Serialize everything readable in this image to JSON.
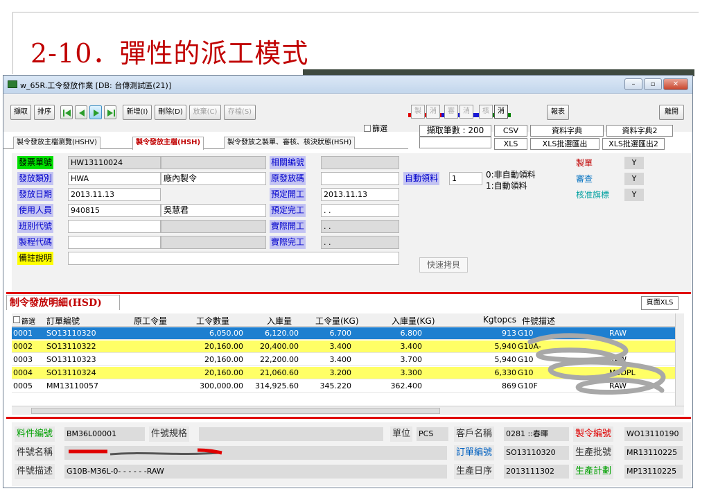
{
  "slide": {
    "title": "2-10．彈性的派工模式"
  },
  "window": {
    "title": "w_65R.工令發放作業 [DB: 台傳測試區(21)]",
    "controls": [
      "–",
      "▫",
      "✕"
    ]
  },
  "toolbar": {
    "fetch": "擷取",
    "sort": "排序",
    "new": "新增(I)",
    "delete": "刪除(D)",
    "abandon": "放棄(C)",
    "save": "存檔(S)",
    "small_buttons": [
      "製",
      "消",
      "審",
      "消",
      "核",
      "消"
    ],
    "report": "報表",
    "leave": "離開",
    "filter_label": "篩選",
    "count_text": "擷取筆數 : 200",
    "csv": "CSV",
    "xls": "XLS",
    "dict": "資料字典",
    "dict2": "資料字典2",
    "batch_export": "XLS批選匯出",
    "batch_export2": "XLS批選匯出2",
    "colors": {
      "red": "#e00000",
      "blue": "#1a1ad6",
      "green": "#008000"
    }
  },
  "tabs": [
    "製令發放主檔瀏覽(HSHV)",
    "製令發放主檔(HSH)",
    "製令發放之製單、審核、核決狀態(HSH)"
  ],
  "header": {
    "fields": [
      {
        "label": "發票單號",
        "value": "HW13110024",
        "extra": ""
      },
      {
        "label": "發放類別",
        "value": "HWA",
        "extra": "廠內製令"
      },
      {
        "label": "發放日期",
        "value": "2013.11.13",
        "extra": ""
      },
      {
        "label": "使用人員",
        "value": "940815",
        "extra": "吳慧君"
      },
      {
        "label": "班別代號",
        "value": "",
        "extra": ""
      },
      {
        "label": "製程代碼",
        "value": "",
        "extra": ""
      },
      {
        "label": "備註說明",
        "value": ""
      }
    ],
    "mid_fields": [
      {
        "label": "相關編號",
        "value": ""
      },
      {
        "label": "原發放碼",
        "value": ""
      },
      {
        "label": "預定開工",
        "value": "2013.11.13"
      },
      {
        "label": "預定完工",
        "value": ". ."
      },
      {
        "label": "實際開工",
        "value": ". ."
      },
      {
        "label": "實際完工",
        "value": ". ."
      }
    ],
    "auto": {
      "label": "自動領料",
      "value": "1",
      "opt0": "0:非自動領料",
      "opt1": "1:自動領料"
    },
    "status": [
      {
        "label": "製單",
        "value": "Y"
      },
      {
        "label": "審查",
        "value": "Y"
      },
      {
        "label": "核准旗標",
        "value": "Y"
      }
    ],
    "quick_copy": "快速拷貝"
  },
  "detail": {
    "title": "制令發放明細(HSD)",
    "page_xls": "頁面XLS",
    "columns": [
      "篩選",
      "訂單編號",
      "原工令量",
      "工令數量",
      "入庫量",
      "工令量(KG)",
      "入庫量(KG)",
      "Kgtopcs",
      "件號描述"
    ],
    "rows": [
      {
        "no": "0001",
        "order": "SO13110320",
        "orig": "",
        "qty": "6,050.00",
        "in": "6,120.00",
        "kg": "6.700",
        "inkg": "6.800",
        "kgp": "913",
        "desc": "G10",
        "desc2": "RAW"
      },
      {
        "no": "0002",
        "order": "SO13110322",
        "orig": "",
        "qty": "20,160.00",
        "in": "20,400.00",
        "kg": "3.400",
        "inkg": "3.400",
        "kgp": "5,940",
        "desc": "G10A-",
        "desc2": ""
      },
      {
        "no": "0003",
        "order": "SO13110323",
        "orig": "",
        "qty": "20,160.00",
        "in": "22,200.00",
        "kg": "3.400",
        "inkg": "3.700",
        "kgp": "5,940",
        "desc": "G10",
        "desc2": "RAW"
      },
      {
        "no": "0004",
        "order": "SO13110324",
        "orig": "",
        "qty": "20,160.00",
        "in": "21,060.60",
        "kg": "3.200",
        "inkg": "3.300",
        "kgp": "6,330",
        "desc": "G10",
        "desc2": "M3DPL"
      },
      {
        "no": "0005",
        "order": "MM13110057",
        "orig": "",
        "qty": "300,000.00",
        "in": "314,925.60",
        "kg": "345.220",
        "inkg": "362.400",
        "kgp": "869",
        "desc": "G10F",
        "desc2": "RAW"
      }
    ]
  },
  "bottom": {
    "part_no_label": "料件編號",
    "part_no": "BM36L00001",
    "spec_label": "件號規格",
    "spec": "",
    "unit_label": "單位",
    "unit": "PCS",
    "customer_label": "客戶名稱",
    "customer": "0281 ::春暉",
    "mo_label": "製令編號",
    "mo": "WO13110190",
    "name_label": "件號名稱",
    "name": "",
    "order_label": "訂單編號",
    "order": "SO13110320",
    "lot_label": "生產批號",
    "lot": "MR13110225",
    "desc_label": "件號描述",
    "desc": "G10B-M36L-0- - - - - -RAW",
    "seq_label": "生產日序",
    "seq": "2013111302",
    "plan_label": "生產計劃",
    "plan": "MP13110225"
  }
}
